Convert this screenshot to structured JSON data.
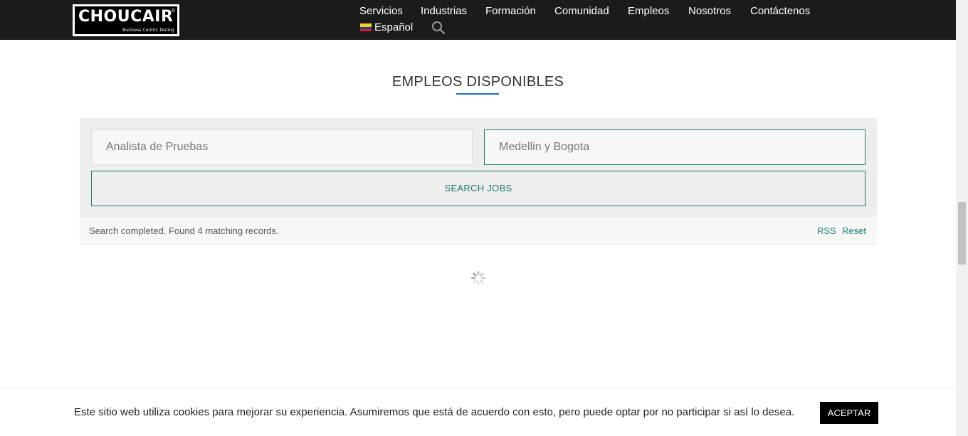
{
  "header": {
    "logo_text": "CHOUCAIR",
    "logo_registered": "®",
    "logo_tagline": "Business Centric Testing",
    "nav": [
      {
        "label": "Servicios"
      },
      {
        "label": "Industrias"
      },
      {
        "label": "Formación"
      },
      {
        "label": "Comunidad"
      },
      {
        "label": "Empleos"
      },
      {
        "label": "Nosotros"
      },
      {
        "label": "Contáctenos"
      }
    ],
    "language": "Español",
    "search_icon": "search-icon",
    "flag_icon": "colombia-flag-icon"
  },
  "section": {
    "title": "EMPLEOS DISPONIBLES",
    "accent_color": "#1e73be"
  },
  "search": {
    "keyword_value": "Analista de Pruebas",
    "location_value": "Medellin y Bogota",
    "button_label": "SEARCH JOBS",
    "accent_color": "#1e7a72"
  },
  "results": {
    "status": "Search completed. Found 4 matching records.",
    "rss_label": "RSS",
    "reset_label": "Reset",
    "loading_icon": "spinner-icon"
  },
  "cookie": {
    "text": "Este sitio web utiliza cookies para mejorar su experiencia. Asumiremos que está de acuerdo con esto, pero puede optar por no participar si así lo desea.",
    "accept_label": "ACEPTAR"
  }
}
